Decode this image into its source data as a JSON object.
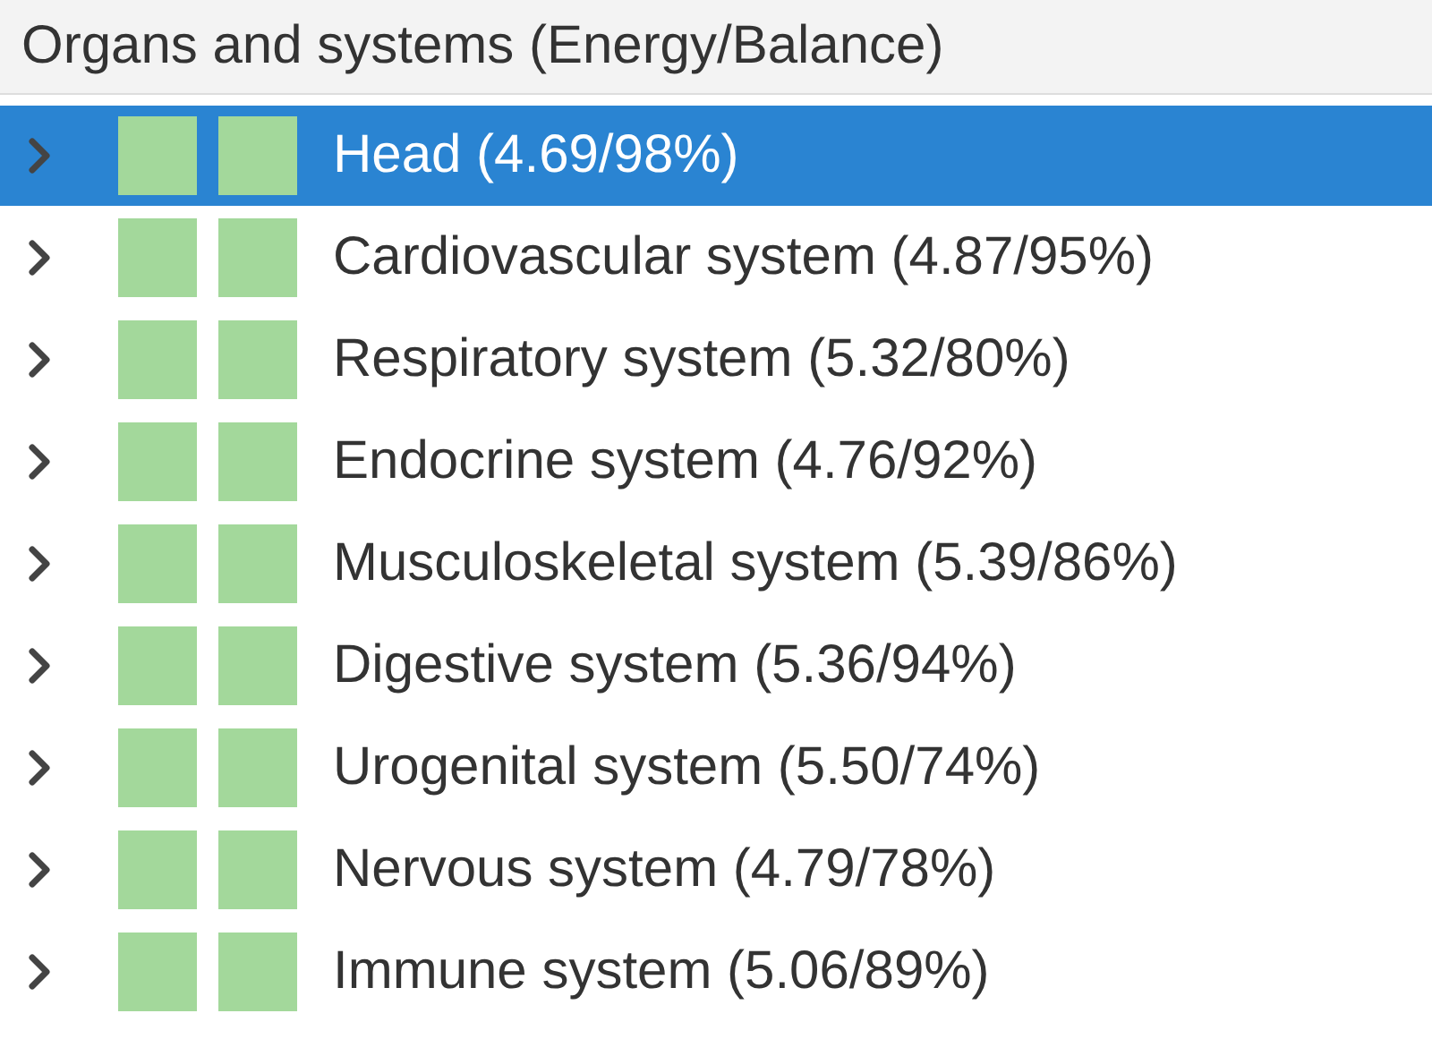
{
  "panel": {
    "title": "Organs and systems (Energy/Balance)"
  },
  "items": [
    {
      "label": "Head (4.69/98%)",
      "selected": true,
      "expanded": false,
      "indicators": [
        {
          "color": "#a3d89b"
        },
        {
          "color": "#a3d89b"
        }
      ]
    },
    {
      "label": "Cardiovascular system (4.87/95%)",
      "selected": false,
      "expanded": false,
      "indicators": [
        {
          "color": "#a3d89b"
        },
        {
          "color": "#a3d89b"
        }
      ]
    },
    {
      "label": "Respiratory system (5.32/80%)",
      "selected": false,
      "expanded": false,
      "indicators": [
        {
          "color": "#a3d89b"
        },
        {
          "color": "#a3d89b"
        }
      ]
    },
    {
      "label": "Endocrine system (4.76/92%)",
      "selected": false,
      "expanded": false,
      "indicators": [
        {
          "color": "#a3d89b"
        },
        {
          "color": "#a3d89b"
        }
      ]
    },
    {
      "label": "Musculoskeletal system (5.39/86%)",
      "selected": false,
      "expanded": false,
      "indicators": [
        {
          "color": "#a3d89b"
        },
        {
          "color": "#a3d89b"
        }
      ]
    },
    {
      "label": "Digestive system (5.36/94%)",
      "selected": false,
      "expanded": false,
      "indicators": [
        {
          "color": "#a3d89b"
        },
        {
          "color": "#a3d89b"
        }
      ]
    },
    {
      "label": "Urogenital system (5.50/74%)",
      "selected": false,
      "expanded": false,
      "indicators": [
        {
          "color": "#a3d89b"
        },
        {
          "color": "#a3d89b"
        }
      ]
    },
    {
      "label": "Nervous system (4.79/78%)",
      "selected": false,
      "expanded": false,
      "indicators": [
        {
          "color": "#a3d89b"
        },
        {
          "color": "#a3d89b"
        }
      ]
    },
    {
      "label": "Immune system (5.06/89%)",
      "selected": false,
      "expanded": false,
      "indicators": [
        {
          "color": "#a3d89b"
        },
        {
          "color": "#a3d89b"
        }
      ]
    }
  ]
}
